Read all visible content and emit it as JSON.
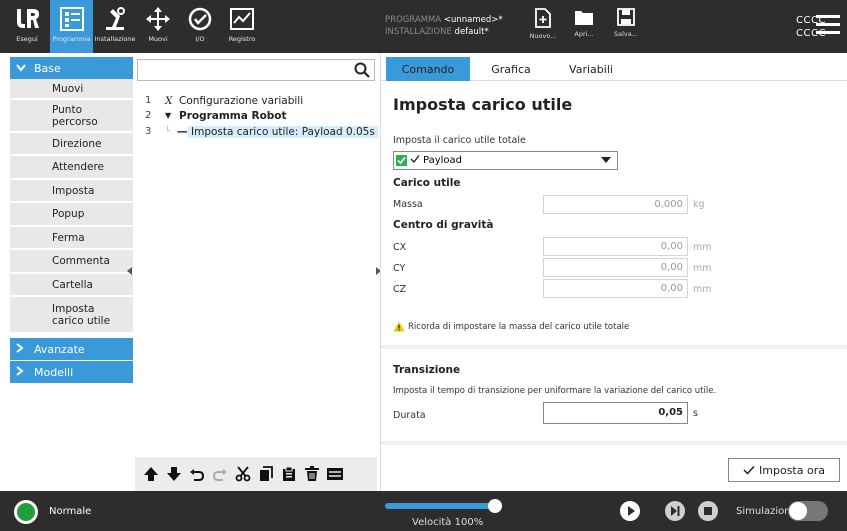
{
  "topbar": {
    "tabs": [
      {
        "label": "Esegui",
        "icon": "ur-logo-icon"
      },
      {
        "label": "Programma",
        "icon": "program-icon",
        "active": true
      },
      {
        "label": "Installazione",
        "icon": "installation-icon"
      },
      {
        "label": "Muovi",
        "icon": "move-icon"
      },
      {
        "label": "I/O",
        "icon": "io-icon"
      },
      {
        "label": "Registro",
        "icon": "log-icon"
      }
    ],
    "programma_label": "PROGRAMMA",
    "programma_value": "<unnamed>*",
    "installazione_label": "INSTALLAZIONE",
    "installazione_value": "default*",
    "file_buttons": [
      {
        "label": "Nuovo...",
        "icon": "new-file-icon"
      },
      {
        "label": "Apri...",
        "icon": "folder-icon"
      },
      {
        "label": "Salva...",
        "icon": "save-icon"
      }
    ],
    "right_line1": "CCCC",
    "right_line2": "CCCC"
  },
  "leftnav": {
    "base_label": "Base",
    "items": [
      {
        "label": "Muovi"
      },
      {
        "label": "Punto percorso"
      },
      {
        "label": "Direzione"
      },
      {
        "label": "Attendere"
      },
      {
        "label": "Imposta"
      },
      {
        "label": "Popup"
      },
      {
        "label": "Ferma"
      },
      {
        "label": "Commenta"
      },
      {
        "label": "Cartella"
      },
      {
        "label": "Imposta carico utile"
      }
    ],
    "advanced_label": "Avanzate",
    "templates_label": "Modelli"
  },
  "tree": {
    "search_placeholder": "",
    "lines": [
      {
        "num": "1",
        "marker": "X",
        "label": "Configurazione variabili"
      },
      {
        "num": "2",
        "marker": "▼",
        "label": "Programma Robot"
      },
      {
        "num": "3",
        "marker": "—",
        "label": "Imposta carico utile: Payload 0.05s"
      }
    ]
  },
  "right": {
    "tabs": [
      "Comando",
      "Grafica",
      "Variabili"
    ],
    "title": "Imposta carico utile",
    "total_payload_label": "Imposta il carico utile totale",
    "payload_select": "Payload",
    "carico_utile_heading": "Carico utile",
    "massa_label": "Massa",
    "massa_value": "0,000",
    "massa_unit": "kg",
    "cog_heading": "Centro di gravità",
    "cx_label": "CX",
    "cx_value": "0,00",
    "cy_label": "CY",
    "cy_value": "0,00",
    "cz_label": "CZ",
    "cz_value": "0,00",
    "mm_unit": "mm",
    "warning_text": "Ricorda di impostare la massa del carico utile totale",
    "transition_heading": "Transizione",
    "transition_desc": "Imposta il tempo di transizione per uniformare la variazione del carico utile.",
    "durata_label": "Durata",
    "durata_value": "0,05",
    "durata_unit": "s",
    "apply_label": "Imposta ora"
  },
  "bottombar": {
    "status": "Normale",
    "speed_label": "Velocità 100%",
    "speed_fraction": 1.0,
    "simulation_label": "Simulazione"
  }
}
